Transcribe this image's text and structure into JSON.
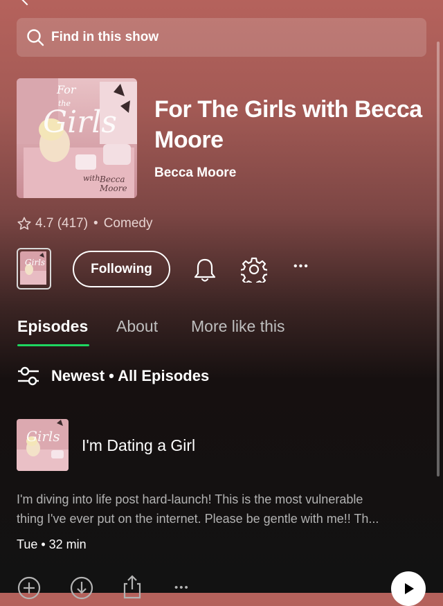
{
  "search": {
    "placeholder": "Find in this show"
  },
  "show": {
    "title": "For The Girls with Becca Moore",
    "author": "Becca Moore",
    "rating": "4.7 (417)",
    "separator": "•",
    "category": "Comedy"
  },
  "actions": {
    "follow_label": "Following",
    "more_label": "•••"
  },
  "tabs": [
    {
      "label": "Episodes",
      "active": true
    },
    {
      "label": "About",
      "active": false
    },
    {
      "label": "More like this",
      "active": false
    }
  ],
  "filter": {
    "label": "Newest • All Episodes"
  },
  "episode": {
    "title": "I'm Dating a Girl",
    "description_line1": "I'm diving into life post hard-launch! This is the most vulnerable",
    "description_line2": "thing I've ever put on the internet. Please be gentle with me!! Th...",
    "meta": "Tue • 32 min",
    "more_label": "•••"
  },
  "colors": {
    "accent": "#1ed760",
    "header_top": "#b5625c",
    "background": "#121212"
  },
  "icons": [
    "back-chevron-icon",
    "search-icon",
    "star-icon",
    "bell-icon",
    "gear-icon",
    "more-icon",
    "filter-sliders-icon",
    "add-circle-icon",
    "download-icon",
    "share-icon",
    "play-icon"
  ]
}
